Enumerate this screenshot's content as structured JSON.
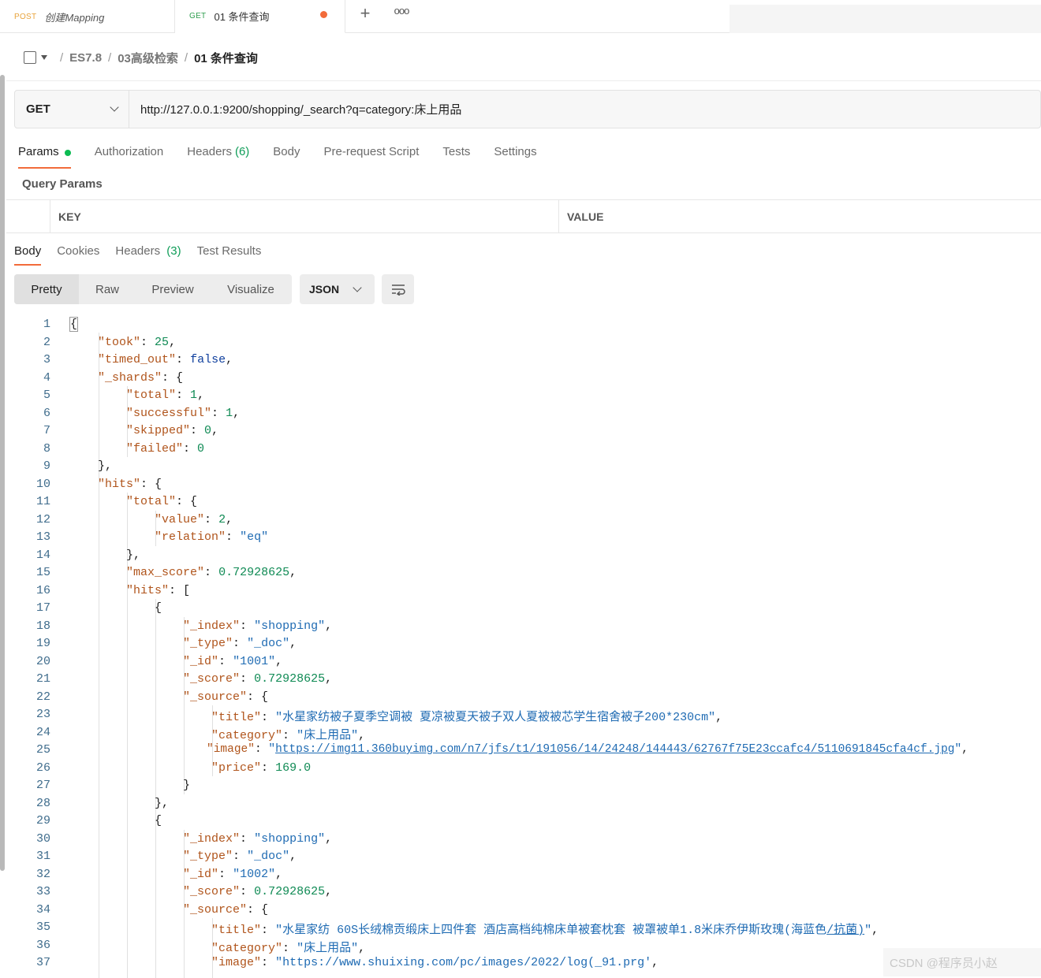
{
  "tabs": [
    {
      "method": "POST",
      "title": "创建Mapping"
    },
    {
      "method": "GET",
      "title": "01 条件查询"
    }
  ],
  "breadcrumb": {
    "items": [
      "ES7.8",
      "03高级检索"
    ],
    "current": "01 条件查询"
  },
  "request": {
    "method": "GET",
    "url": "http://127.0.0.1:9200/shopping/_search?q=category:床上用品"
  },
  "request_tabs": {
    "params": "Params",
    "authorization": "Authorization",
    "headers": "Headers",
    "headers_count": "(6)",
    "body": "Body",
    "prerequest": "Pre-request Script",
    "tests": "Tests",
    "settings": "Settings"
  },
  "query_params": {
    "title": "Query Params",
    "key_header": "KEY",
    "value_header": "VALUE"
  },
  "response_tabs": {
    "body": "Body",
    "cookies": "Cookies",
    "headers": "Headers",
    "headers_count": "(3)",
    "test_results": "Test Results"
  },
  "view": {
    "pretty": "Pretty",
    "raw": "Raw",
    "preview": "Preview",
    "visualize": "Visualize",
    "format": "JSON"
  },
  "response": {
    "took": "25",
    "timed_out": "false",
    "shards": {
      "total": "1",
      "successful": "1",
      "skipped": "0",
      "failed": "0"
    },
    "hits_total": {
      "value": "2",
      "relation": "\"eq\""
    },
    "max_score": "0.72928625",
    "hit1": {
      "index": "\"shopping\"",
      "type": "\"_doc\"",
      "id": "\"1001\"",
      "score": "0.72928625",
      "title": "\"水星家纺被子夏季空调被 夏凉被夏天被子双人夏被被芯学生宿舍被子200*230cm\"",
      "category": "\"床上用品\"",
      "image": "https://img11.360buyimg.com/n7/jfs/t1/191056/14/24248/144443/62767f75E23ccafc4/5110691845cfa4cf.jpg",
      "price": "169.0"
    },
    "hit2": {
      "index": "\"shopping\"",
      "type": "\"_doc\"",
      "id": "\"1002\"",
      "score": "0.72928625",
      "title_pre": "\"水星家纺 60S长绒棉贡缎床上四件套 酒店高档纯棉床单被套枕套 被罩被单1.8米床乔伊斯玫瑰(海蓝色",
      "title_link": "/抗菌)",
      "title_post": "\"",
      "category": "\"床上用品\"",
      "image": "\"https://www.shuixing.com/pc/images/2022/log(_91.prg'"
    }
  },
  "watermark": "CSDN @程序员小赵"
}
